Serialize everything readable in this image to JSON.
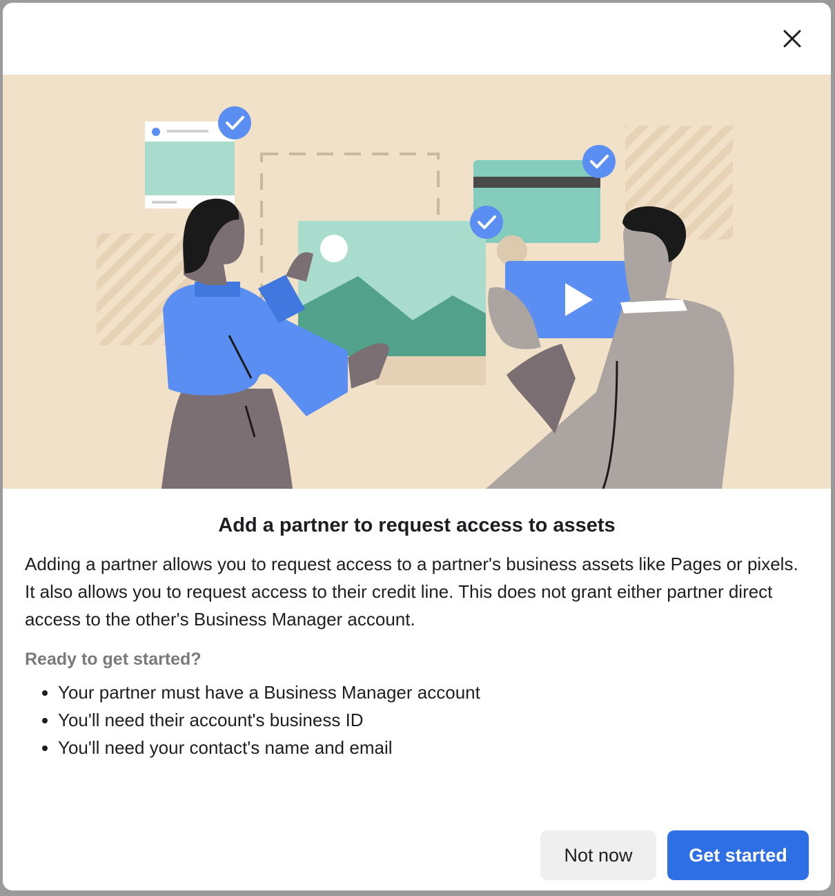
{
  "dialog": {
    "title": "Add a partner to request access to assets",
    "description": "Adding a partner allows you to request access to a partner's business assets like Pages or pixels. It also allows you to request access to their credit line. This does not grant either partner direct access to the other's Business Manager account.",
    "subheading": "Ready to get started?",
    "requirements": [
      "Your partner must have a Business Manager account",
      "You'll need their account's business ID",
      "You'll need your contact's name and email"
    ],
    "buttons": {
      "not_now": "Not now",
      "get_started": "Get started"
    }
  },
  "icons": {
    "close": "close-icon",
    "check": "check-badge-icon",
    "play": "play-icon"
  },
  "colors": {
    "primary": "#2e6fe5",
    "hero_background": "#f1e1c8",
    "badge": "#5b8ef2"
  }
}
